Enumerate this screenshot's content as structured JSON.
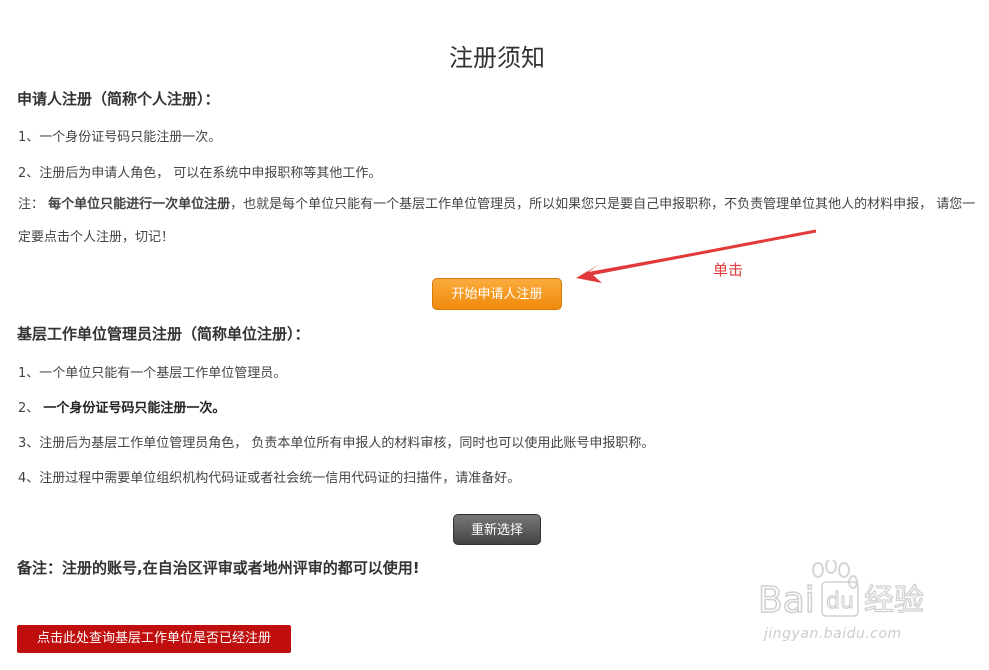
{
  "page": {
    "title": "注册须知"
  },
  "personal": {
    "heading": "申请人注册（简称个人注册）：",
    "item1": "1、一个身份证号码只能注册一次。",
    "item2": "2、注册后为申请人角色， 可以在系统中申报职称等其他工作。",
    "note_prefix": "注：",
    "note_bold": "每个单位只能进行一次单位注册",
    "note_rest": "，也就是每个单位只能有一个基层工作单位管理员，所以如果您只是要自己申报职称，不负责管理单位其他人的材料申报， 请您一定要点击个人注册，切记！",
    "button_label": "开始申请人注册"
  },
  "annotation": {
    "label": "单击",
    "color": "#e23a3a"
  },
  "unit": {
    "heading": "基层工作单位管理员注册（简称单位注册）：",
    "item1": "1、一个单位只能有一个基层工作单位管理员。",
    "item2_prefix": "2、",
    "item2_bold": "一个身份证号码只能注册一次。",
    "item3": "3、注册后为基层工作单位管理员角色， 负责本单位所有申报人的材料审核，同时也可以使用此账号申报职称。",
    "item4": "4、注册过程中需要单位组织机构代码证或者社会统一信用代码证的扫描件，请准备好。",
    "reselect_label": "重新选择"
  },
  "remark": "备注：注册的账号,在自治区评审或者地州评审的都可以使用!",
  "query_button_label": "点击此处查询基层工作单位是否已经注册",
  "watermark": {
    "logo": "Bai du 经验",
    "url": "jingyan.baidu.com"
  },
  "colors": {
    "orange": "#f08a0c",
    "gray": "#555555",
    "red": "#c00d0d"
  }
}
